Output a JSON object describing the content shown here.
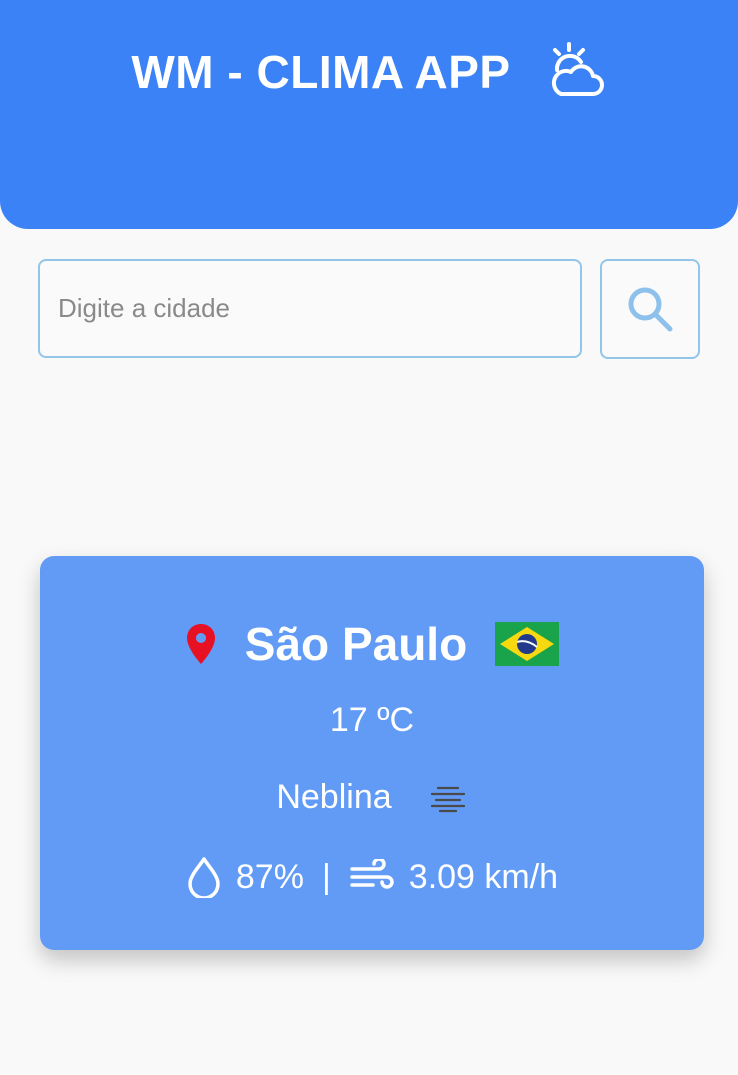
{
  "header": {
    "title": "WM - CLIMA APP",
    "icon": "sun-behind-cloud-icon",
    "background": "#3b82f6"
  },
  "search": {
    "placeholder": "Digite a cidade",
    "value": "",
    "button_icon": "search-icon"
  },
  "weather": {
    "city": "São Paulo",
    "country_flag": "brazil-flag-icon",
    "location_icon": "map-pin-icon",
    "temperature": "17 ºC",
    "description": "Neblina",
    "description_icon": "fog-icon",
    "humidity_icon": "water-drop-icon",
    "humidity": "87%",
    "separator": "|",
    "wind_icon": "wind-icon",
    "wind_speed": "3.09 km/h",
    "card_color": "#629bf5"
  }
}
